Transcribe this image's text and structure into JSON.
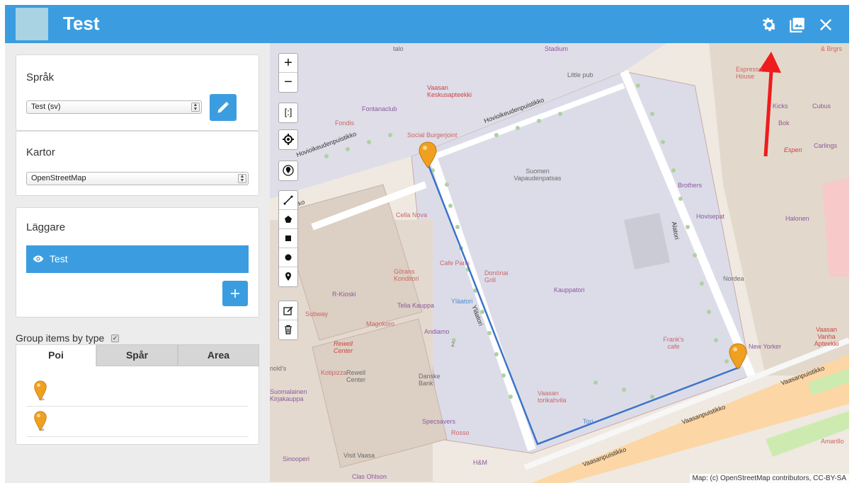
{
  "header": {
    "title": "Test"
  },
  "sidebar": {
    "language": {
      "label": "Språk",
      "selected": "Test (sv)"
    },
    "maps": {
      "label": "Kartor",
      "selected": "OpenStreetMap"
    },
    "layers": {
      "label": "Läggare",
      "items": [
        {
          "label": "Test"
        }
      ]
    },
    "group_by_type": {
      "label": "Group items by type",
      "checked": true
    },
    "tabs": [
      {
        "label": "Poi"
      },
      {
        "label": "Spår"
      },
      {
        "label": "Area"
      }
    ],
    "poi_items_count_shown": 2
  },
  "map": {
    "attribution": "Map: (c) OpenStreetMap contributors, CC-BY-SA",
    "labels": {
      "stadium": "Stadium",
      "little_pub": "Little pub",
      "vaasan_keskus": "Vaasan Keskusapteekki",
      "fontanaclub": "Fontanaclub",
      "fondis": "Fondis",
      "social_burger": "Social Burgerjoint",
      "hovioikeuden1": "Hovioikeudenpuistikko",
      "hovioikeuden2": "Hovioikeudenpuistikko",
      "suomen": "Suomen Vapaudenpatsas",
      "puistikko": "puistikko",
      "cella_nova": "Cella Nova",
      "gorans": "Görans Konditori",
      "cafe_paris": "Cafe Paris",
      "dononai": "Donönai Grill",
      "kauppatori": "Kauppatori",
      "r_kioski": "R-Kioski",
      "telia": "Telia Kauppa",
      "ylatori": "Yläatori",
      "ylatori2": "Yläatori",
      "subway": "Subway",
      "magokoro": "Magokoro",
      "andiamo": "Andiamo",
      "rewell": "Rewell Center",
      "kotipizza": "Kotipizza",
      "rewell_center": "Rewell Center",
      "danske": "Danske Bank",
      "suomalainen": "Suomalainen Kirjakauppa",
      "vaasan_tori": "Vaasan torikahvila",
      "specsavers": "Specsavers",
      "rosso": "Rosso",
      "visit_vaasa": "Visit Vaasa",
      "hm": "H&M",
      "clas": "Clas Ohlson",
      "sinooperi": "Sinooperi",
      "tori": "Tori",
      "alatori": "Alatori",
      "espresso": "Espresso House",
      "kicks": "Kicks",
      "cubus": "Cubus",
      "bok": "Bok",
      "carlings": "Carlings",
      "espen": "Espen",
      "brothers": "Brothers",
      "hovisepat": "Hovisepat",
      "halonen": "Halonen",
      "nordea": "Nordea",
      "franks": "Frank's cafe",
      "new_yorker": "New Yorker",
      "vaasan_vanha": "Vaasan Vanha Apteekki",
      "vaasanpuistikko1": "Vaasanpuistikko",
      "vaasanpuistikko2": "Vaasanpuistikko",
      "vaasanpuistikko3": "Vaasanpuistikko",
      "amarillo": "Amarillo",
      "brgrs": "& Brgrs",
      "talo": "talo",
      "num2": "2",
      "nolds": "nold's"
    }
  }
}
